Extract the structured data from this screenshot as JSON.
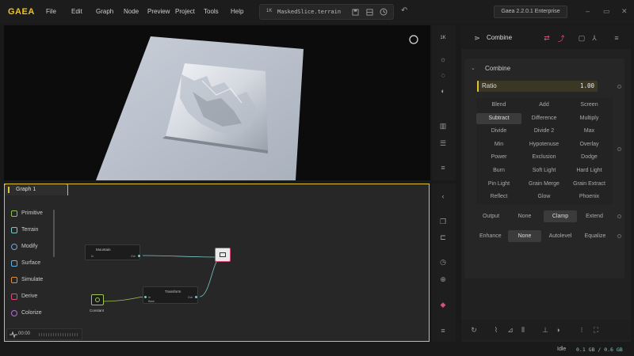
{
  "app": {
    "name": "GAEA",
    "edition": "Gaea 2.2.0.1 Enterprise"
  },
  "menu": [
    "File",
    "Edit",
    "Graph",
    "Node",
    "Preview",
    "Project",
    "Tools",
    "Help"
  ],
  "file": {
    "resolution": "1K",
    "name": "MaskedSlice.terrain"
  },
  "viewport": {
    "toolbar_top_label": "1K"
  },
  "graph": {
    "tab_label": "Graph 1",
    "categories": [
      {
        "label": "Primitive",
        "color": "#8fbf5a"
      },
      {
        "label": "Terrain",
        "color": "#7bc6c0"
      },
      {
        "label": "Modify",
        "color": "#6fa8dc"
      },
      {
        "label": "Surface",
        "color": "#5fb6e0"
      },
      {
        "label": "Simulate",
        "color": "#e08a3c"
      },
      {
        "label": "Derive",
        "color": "#d94f7a"
      },
      {
        "label": "Colorize",
        "color": "#b46cd9"
      }
    ],
    "nodes": {
      "mountain": {
        "title": "Mountain",
        "port_in": "In",
        "port_out": "Out"
      },
      "transform": {
        "title": "Transform",
        "port_in": "In",
        "port_in2": "Base",
        "port_out": "Out"
      },
      "constant": {
        "title": "Constant"
      }
    },
    "timeline": "00:00"
  },
  "properties": {
    "node_name": "Combine",
    "section_title": "Combine",
    "ratio": {
      "label": "Ratio",
      "value": "1.00"
    },
    "blend_modes": [
      "Blend",
      "Add",
      "Screen",
      "Subtract",
      "Difference",
      "Multiply",
      "Divide",
      "Divide 2",
      "Max",
      "Min",
      "Hypotenuse",
      "Overlay",
      "Power",
      "Exclusion",
      "Dodge",
      "Burn",
      "Soft Light",
      "Hard Light",
      "Pin Light",
      "Grain Merge",
      "Grain Extract",
      "Reflect",
      "Glow",
      "Phoenix"
    ],
    "selected_blend": "Subtract",
    "output": {
      "label": "Output",
      "options": [
        "None",
        "Clamp",
        "Extend"
      ],
      "selected": "Clamp"
    },
    "enhance": {
      "label": "Enhance",
      "options": [
        "None",
        "Autolevel",
        "Equalize"
      ],
      "selected": "None"
    }
  },
  "status": {
    "state": "Idle",
    "memory": "0.1 GB / 0.6 GB"
  },
  "colors": {
    "accent": "#e0c12f",
    "link": "#7bc6c0"
  }
}
